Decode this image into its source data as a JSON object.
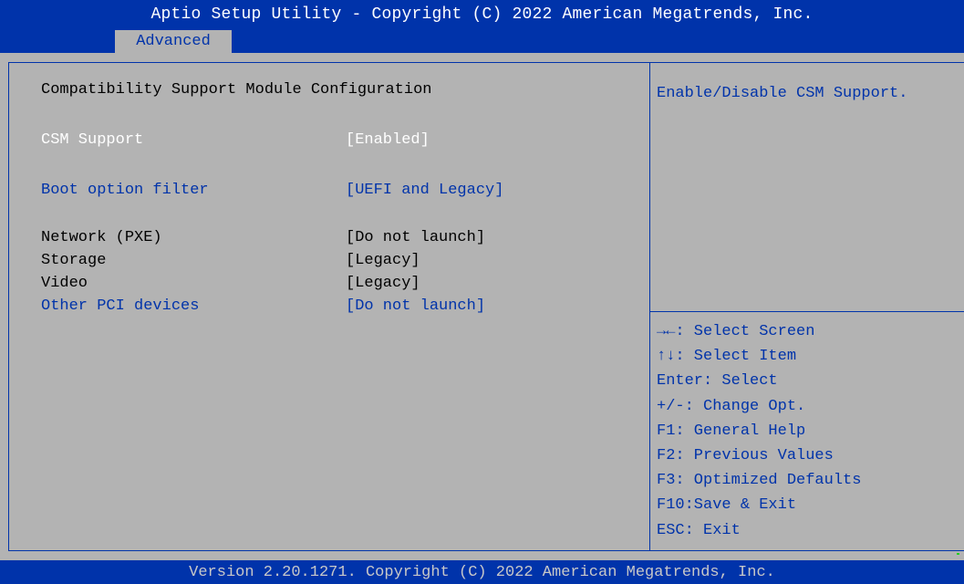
{
  "header": {
    "title": "Aptio Setup Utility - Copyright (C) 2022 American Megatrends, Inc.",
    "active_tab": "Advanced"
  },
  "main": {
    "section_title": "Compatibility Support Module Configuration",
    "settings": [
      {
        "label": "CSM Support",
        "value": "[Enabled]"
      },
      {
        "label": "Boot option filter",
        "value": "[UEFI and Legacy]"
      },
      {
        "label": "Network (PXE)",
        "value": "[Do not launch]"
      },
      {
        "label": "Storage",
        "value": "[Legacy]"
      },
      {
        "label": "Video",
        "value": "[Legacy]"
      },
      {
        "label": "Other PCI devices",
        "value": "[Do not launch]"
      }
    ]
  },
  "help": {
    "text": "Enable/Disable CSM Support."
  },
  "keys": [
    "→←: Select Screen",
    "↑↓: Select Item",
    "Enter: Select",
    "+/-: Change Opt.",
    "F1: General Help",
    "F2: Previous Values",
    "F3: Optimized Defaults",
    "F10:Save & Exit",
    "ESC: Exit"
  ],
  "footer": {
    "text": "Version 2.20.1271. Copyright (C) 2022 American Megatrends, Inc."
  },
  "colors": {
    "background": "#b3b3b3",
    "bios_blue": "#0033aa",
    "selected_text": "#ffffff"
  }
}
